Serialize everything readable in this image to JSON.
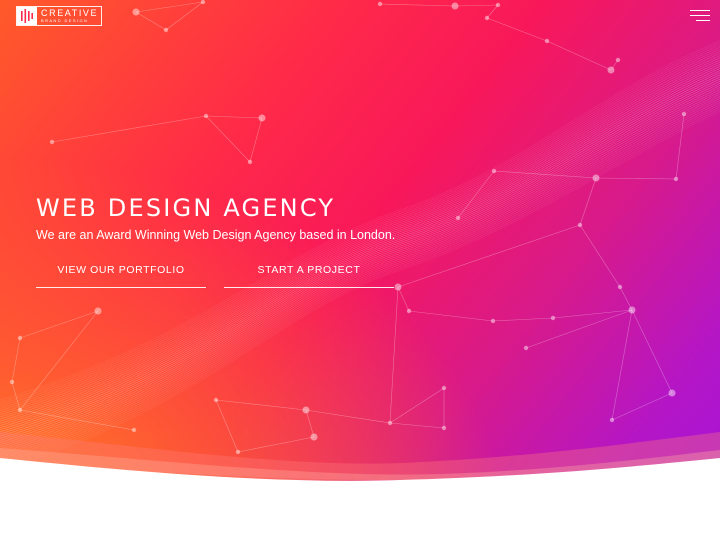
{
  "logo": {
    "title": "CREATIVE",
    "subtitle": "BRAND DESIGN"
  },
  "nav": {
    "menu_icon": "hamburger-menu-icon"
  },
  "hero": {
    "headline": "WEB DESIGN AGENCY",
    "subheadline": "We are an Award Winning Web Design Agency based in London.",
    "buttons": {
      "portfolio": "VIEW OUR PORTFOLIO",
      "project": "START A PROJECT"
    }
  },
  "colors": {
    "orange": "#ff7a1e",
    "red": "#ff1f4b",
    "magenta": "#d81a8a",
    "purple": "#a313dc"
  }
}
